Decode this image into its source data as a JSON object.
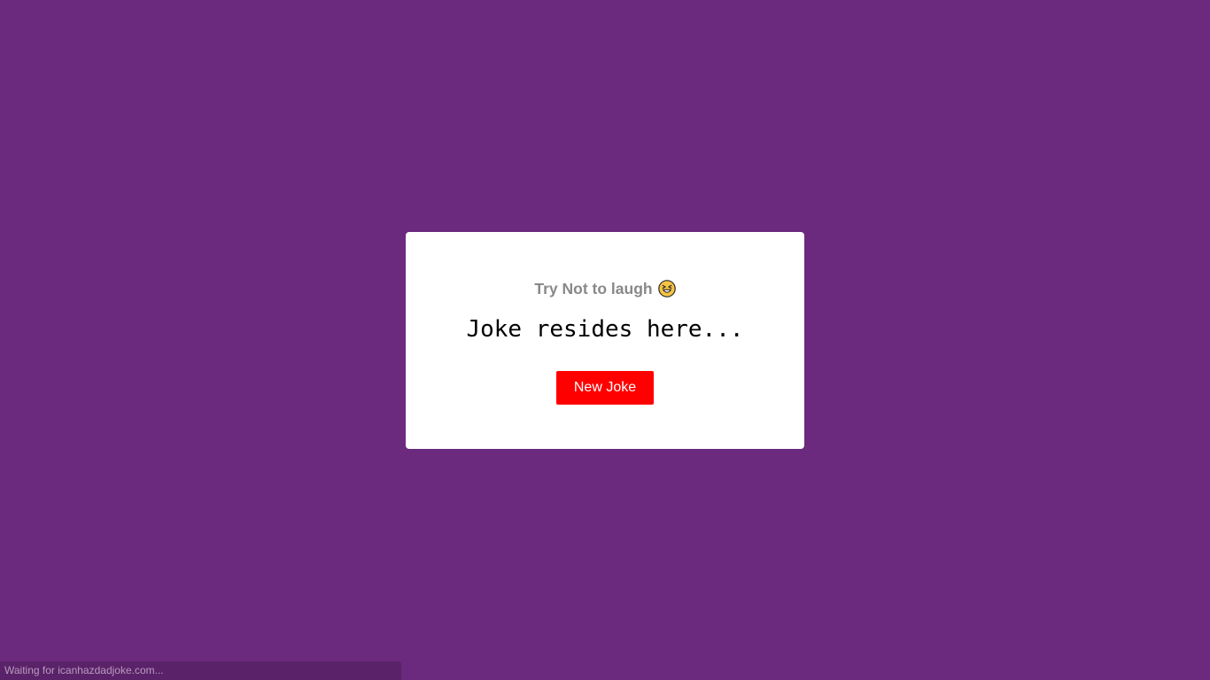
{
  "page": {
    "background_color": "#6b2a7e"
  },
  "card": {
    "heading": "Try Not to laugh",
    "heading_icon": "laughing-face-icon",
    "joke_text": "Joke resides here...",
    "button_label": "New Joke",
    "button_color": "#ff0000"
  },
  "status_bar": {
    "text": "Waiting for icanhazdadjoke.com..."
  }
}
